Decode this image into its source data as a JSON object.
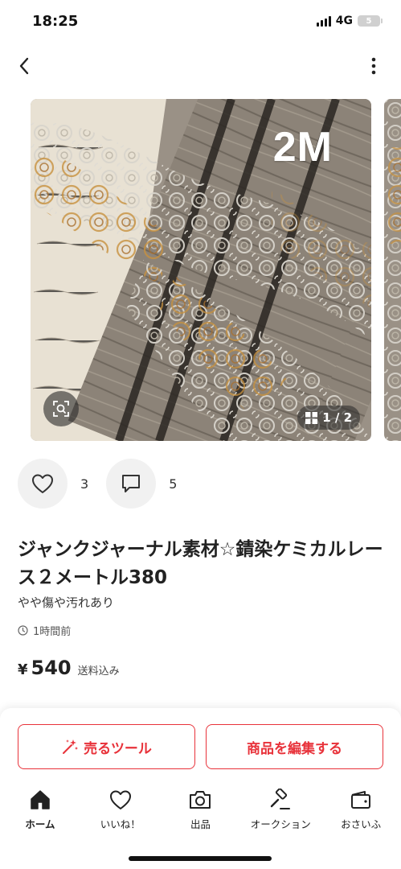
{
  "status_bar": {
    "time": "18:25",
    "network": "4G",
    "battery": "5"
  },
  "header": {
    "back_icon": "chevron-left-icon",
    "more_icon": "vertical-dots-icon"
  },
  "carousel": {
    "overlay_text": "2M",
    "counter": "1 / 2",
    "zoom_icon": "zoom-scan-icon",
    "grid_icon": "grid-icon"
  },
  "engagement": {
    "likes": "3",
    "comments": "5"
  },
  "product": {
    "title": "ジャンクジャーナル素材☆錆染ケミカルレース２メートル380",
    "condition": "やや傷や汚れあり",
    "posted": "1時間前",
    "price_currency": "¥",
    "price": "540",
    "shipping": "送料込み"
  },
  "actions": {
    "sell_tool": "売るツール",
    "edit": "商品を編集する"
  },
  "tabs": [
    {
      "label": "ホーム",
      "icon": "home-icon"
    },
    {
      "label": "いいね！",
      "icon": "heart-icon"
    },
    {
      "label": "出品",
      "icon": "camera-icon"
    },
    {
      "label": "オークション",
      "icon": "gavel-icon"
    },
    {
      "label": "おさいふ",
      "icon": "wallet-icon"
    }
  ],
  "colors": {
    "accent": "#e8323a",
    "text": "#222222",
    "muted_bg": "#f1f1f1"
  }
}
